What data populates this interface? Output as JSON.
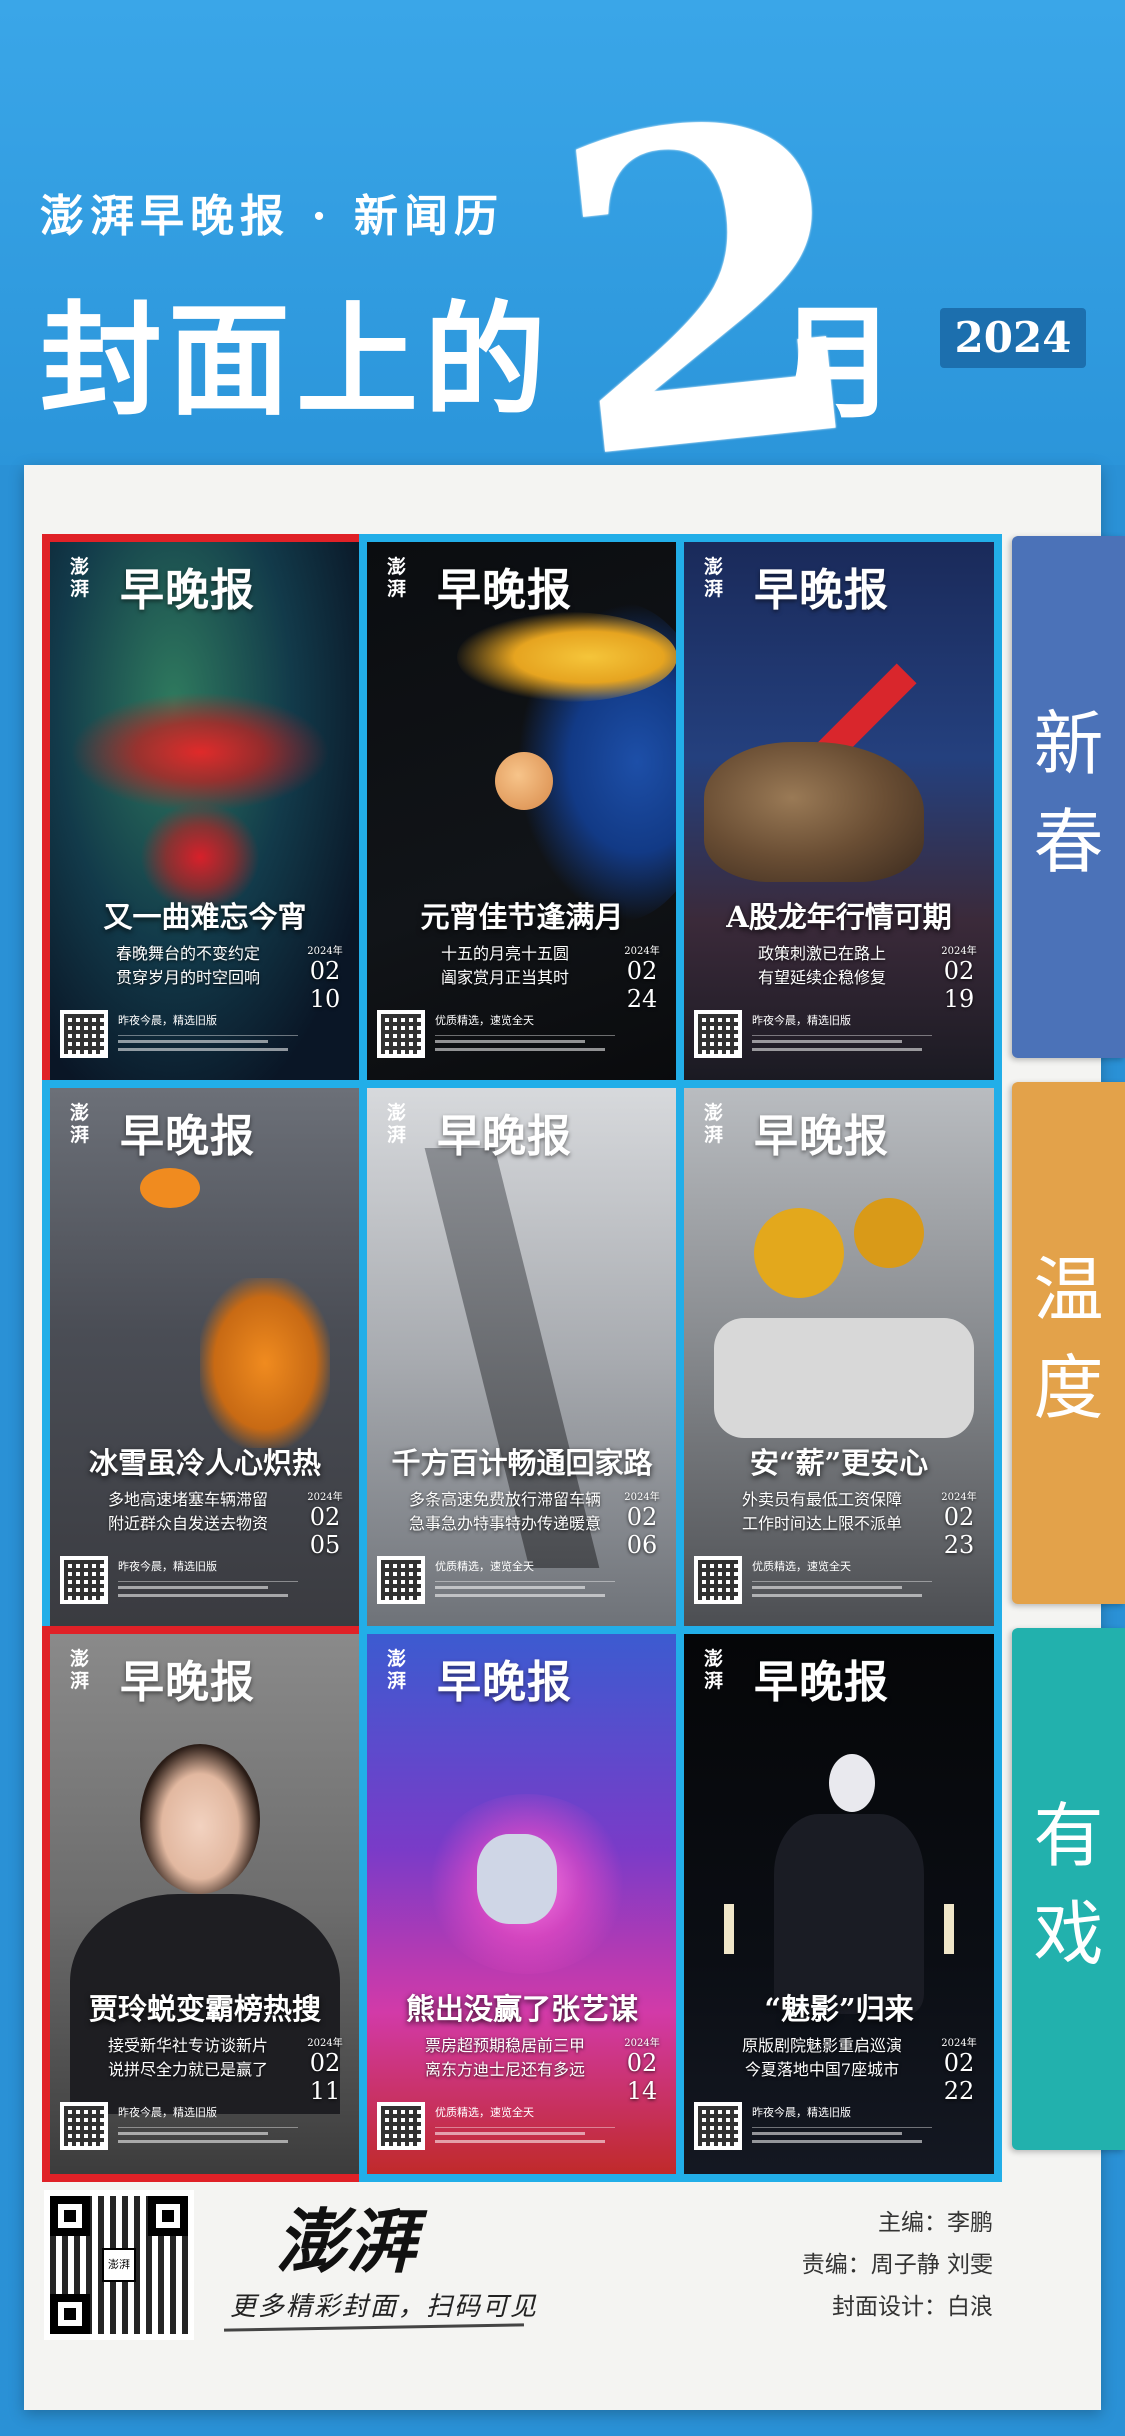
{
  "header": {
    "subtitle": "澎湃早晚报 · 新闻历",
    "title_prefix": "封面上的",
    "big_number": "2",
    "title_suffix": "月",
    "year": "2024"
  },
  "side_tabs": [
    {
      "label_1": "新",
      "label_2": "春",
      "color": "#4b72b8"
    },
    {
      "label_1": "温",
      "label_2": "度",
      "color": "#e3a24a"
    },
    {
      "label_1": "有",
      "label_2": "戏",
      "color": "#22b1ad"
    }
  ],
  "cards": [
    {
      "logo": "早晚报",
      "logo_small": "澎湃",
      "headline": "又一曲难忘今宵",
      "sub_1": "春晚舞台的不变约定",
      "sub_2": "贯穿岁月的时空回响",
      "year": "2024年",
      "month": "02",
      "day": "10",
      "tag": "昨夜今晨，精选旧版"
    },
    {
      "logo": "早晚报",
      "logo_small": "澎湃",
      "headline": "元宵佳节逢满月",
      "sub_1": "十五的月亮十五圆",
      "sub_2": "阖家赏月正当其时",
      "year": "2024年",
      "month": "02",
      "day": "24",
      "tag": "优质精选，速览全天"
    },
    {
      "logo": "早晚报",
      "logo_small": "澎湃",
      "headline": "A股龙年行情可期",
      "sub_1": "政策刺激已在路上",
      "sub_2": "有望延续企稳修复",
      "year": "2024年",
      "month": "02",
      "day": "19",
      "tag": "昨夜今晨，精选旧版"
    },
    {
      "logo": "早晚报",
      "logo_small": "澎湃",
      "headline": "冰雪虽冷人心炽热",
      "sub_1": "多地高速堵塞车辆滞留",
      "sub_2": "附近群众自发送去物资",
      "year": "2024年",
      "month": "02",
      "day": "05",
      "tag": "昨夜今晨，精选旧版"
    },
    {
      "logo": "早晚报",
      "logo_small": "澎湃",
      "headline": "千方百计畅通回家路",
      "sub_1": "多条高速免费放行滞留车辆",
      "sub_2": "急事急办特事特办传递暖意",
      "year": "2024年",
      "month": "02",
      "day": "06",
      "tag": "优质精选，速览全天"
    },
    {
      "logo": "早晚报",
      "logo_small": "澎湃",
      "headline": "安“薪”更安心",
      "sub_1": "外卖员有最低工资保障",
      "sub_2": "工作时间达上限不派单",
      "year": "2024年",
      "month": "02",
      "day": "23",
      "tag": "优质精选，速览全天"
    },
    {
      "logo": "早晚报",
      "logo_small": "澎湃",
      "headline": "贾玲蜕变霸榜热搜",
      "sub_1": "接受新华社专访谈新片",
      "sub_2": "说拼尽全力就已是赢了",
      "year": "2024年",
      "month": "02",
      "day": "11",
      "tag": "昨夜今晨，精选旧版"
    },
    {
      "logo": "早晚报",
      "logo_small": "澎湃",
      "headline": "熊出没赢了张艺谋",
      "sub_1": "票房超预期稳居前三甲",
      "sub_2": "离东方迪士尼还有多远",
      "year": "2024年",
      "month": "02",
      "day": "14",
      "tag": "优质精选，速览全天"
    },
    {
      "logo": "早晚报",
      "logo_small": "澎湃",
      "headline": "“魅影”归来",
      "sub_1": "原版剧院魅影重启巡演",
      "sub_2": "今夏落地中国7座城市",
      "year": "2024年",
      "month": "02",
      "day": "22",
      "tag": "昨夜今晨，精选旧版"
    }
  ],
  "footer": {
    "qr_center": "澎湃",
    "brand": "澎湃",
    "slogan": "更多精彩封面，扫码可见",
    "editor": "主编：李鹏",
    "duty_editor": "责编：周子静  刘雯",
    "designer": "封面设计：白浪"
  },
  "colors": {
    "frame_red": "#e02127",
    "frame_blue": "#22aee8",
    "header_blue": "#2b95da"
  }
}
